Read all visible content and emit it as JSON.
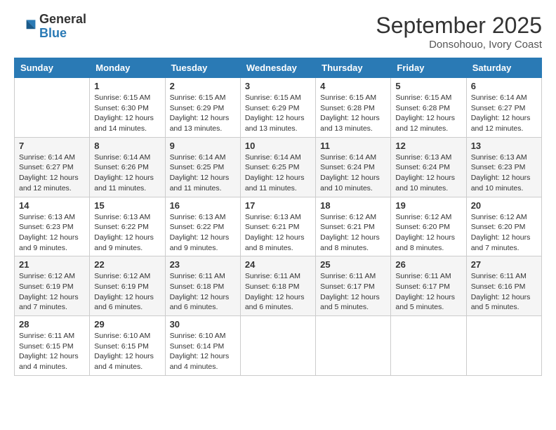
{
  "header": {
    "logo_general": "General",
    "logo_blue": "Blue",
    "month_year": "September 2025",
    "location": "Donsohouo, Ivory Coast"
  },
  "days_of_week": [
    "Sunday",
    "Monday",
    "Tuesday",
    "Wednesday",
    "Thursday",
    "Friday",
    "Saturday"
  ],
  "weeks": [
    [
      {
        "day": "",
        "info": ""
      },
      {
        "day": "1",
        "info": "Sunrise: 6:15 AM\nSunset: 6:30 PM\nDaylight: 12 hours\nand 14 minutes."
      },
      {
        "day": "2",
        "info": "Sunrise: 6:15 AM\nSunset: 6:29 PM\nDaylight: 12 hours\nand 13 minutes."
      },
      {
        "day": "3",
        "info": "Sunrise: 6:15 AM\nSunset: 6:29 PM\nDaylight: 12 hours\nand 13 minutes."
      },
      {
        "day": "4",
        "info": "Sunrise: 6:15 AM\nSunset: 6:28 PM\nDaylight: 12 hours\nand 13 minutes."
      },
      {
        "day": "5",
        "info": "Sunrise: 6:15 AM\nSunset: 6:28 PM\nDaylight: 12 hours\nand 12 minutes."
      },
      {
        "day": "6",
        "info": "Sunrise: 6:14 AM\nSunset: 6:27 PM\nDaylight: 12 hours\nand 12 minutes."
      }
    ],
    [
      {
        "day": "7",
        "info": "Sunrise: 6:14 AM\nSunset: 6:27 PM\nDaylight: 12 hours\nand 12 minutes."
      },
      {
        "day": "8",
        "info": "Sunrise: 6:14 AM\nSunset: 6:26 PM\nDaylight: 12 hours\nand 11 minutes."
      },
      {
        "day": "9",
        "info": "Sunrise: 6:14 AM\nSunset: 6:25 PM\nDaylight: 12 hours\nand 11 minutes."
      },
      {
        "day": "10",
        "info": "Sunrise: 6:14 AM\nSunset: 6:25 PM\nDaylight: 12 hours\nand 11 minutes."
      },
      {
        "day": "11",
        "info": "Sunrise: 6:14 AM\nSunset: 6:24 PM\nDaylight: 12 hours\nand 10 minutes."
      },
      {
        "day": "12",
        "info": "Sunrise: 6:13 AM\nSunset: 6:24 PM\nDaylight: 12 hours\nand 10 minutes."
      },
      {
        "day": "13",
        "info": "Sunrise: 6:13 AM\nSunset: 6:23 PM\nDaylight: 12 hours\nand 10 minutes."
      }
    ],
    [
      {
        "day": "14",
        "info": "Sunrise: 6:13 AM\nSunset: 6:23 PM\nDaylight: 12 hours\nand 9 minutes."
      },
      {
        "day": "15",
        "info": "Sunrise: 6:13 AM\nSunset: 6:22 PM\nDaylight: 12 hours\nand 9 minutes."
      },
      {
        "day": "16",
        "info": "Sunrise: 6:13 AM\nSunset: 6:22 PM\nDaylight: 12 hours\nand 9 minutes."
      },
      {
        "day": "17",
        "info": "Sunrise: 6:13 AM\nSunset: 6:21 PM\nDaylight: 12 hours\nand 8 minutes."
      },
      {
        "day": "18",
        "info": "Sunrise: 6:12 AM\nSunset: 6:21 PM\nDaylight: 12 hours\nand 8 minutes."
      },
      {
        "day": "19",
        "info": "Sunrise: 6:12 AM\nSunset: 6:20 PM\nDaylight: 12 hours\nand 8 minutes."
      },
      {
        "day": "20",
        "info": "Sunrise: 6:12 AM\nSunset: 6:20 PM\nDaylight: 12 hours\nand 7 minutes."
      }
    ],
    [
      {
        "day": "21",
        "info": "Sunrise: 6:12 AM\nSunset: 6:19 PM\nDaylight: 12 hours\nand 7 minutes."
      },
      {
        "day": "22",
        "info": "Sunrise: 6:12 AM\nSunset: 6:19 PM\nDaylight: 12 hours\nand 6 minutes."
      },
      {
        "day": "23",
        "info": "Sunrise: 6:11 AM\nSunset: 6:18 PM\nDaylight: 12 hours\nand 6 minutes."
      },
      {
        "day": "24",
        "info": "Sunrise: 6:11 AM\nSunset: 6:18 PM\nDaylight: 12 hours\nand 6 minutes."
      },
      {
        "day": "25",
        "info": "Sunrise: 6:11 AM\nSunset: 6:17 PM\nDaylight: 12 hours\nand 5 minutes."
      },
      {
        "day": "26",
        "info": "Sunrise: 6:11 AM\nSunset: 6:17 PM\nDaylight: 12 hours\nand 5 minutes."
      },
      {
        "day": "27",
        "info": "Sunrise: 6:11 AM\nSunset: 6:16 PM\nDaylight: 12 hours\nand 5 minutes."
      }
    ],
    [
      {
        "day": "28",
        "info": "Sunrise: 6:11 AM\nSunset: 6:15 PM\nDaylight: 12 hours\nand 4 minutes."
      },
      {
        "day": "29",
        "info": "Sunrise: 6:10 AM\nSunset: 6:15 PM\nDaylight: 12 hours\nand 4 minutes."
      },
      {
        "day": "30",
        "info": "Sunrise: 6:10 AM\nSunset: 6:14 PM\nDaylight: 12 hours\nand 4 minutes."
      },
      {
        "day": "",
        "info": ""
      },
      {
        "day": "",
        "info": ""
      },
      {
        "day": "",
        "info": ""
      },
      {
        "day": "",
        "info": ""
      }
    ]
  ]
}
